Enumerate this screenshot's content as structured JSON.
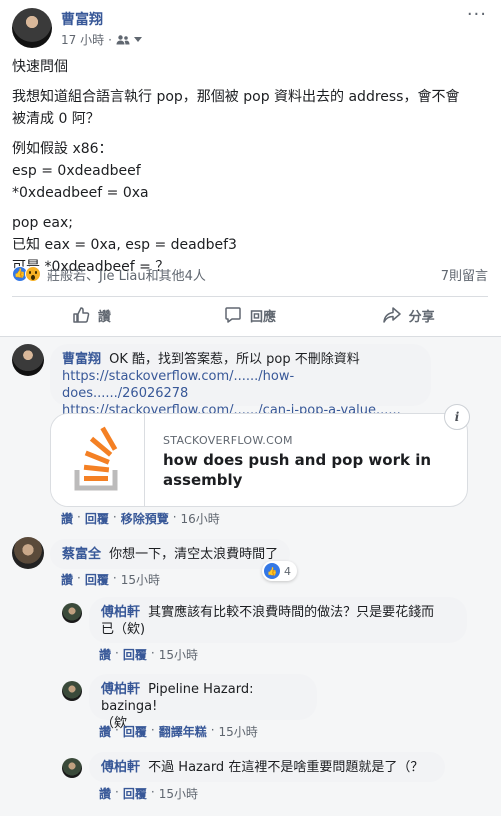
{
  "post": {
    "author": "曹富翔",
    "time": "17 小時",
    "more": "···",
    "lines": [
      "快速問個",
      "我想知道組合語言執行 pop，那個被 pop 資料出去的 address，會不會",
      "被清成 0 阿？",
      "例如假設 x86：",
      "esp = 0xdeadbeef",
      "*0xdeadbeef = 0xa",
      "pop eax;",
      "已知 eax = 0xa, esp = deadbef3",
      "可是 *0xdeadbeef = ？"
    ],
    "reaction_names": "莊般若、Jie Liau和其他4人",
    "comment_count": "7則留言",
    "actions": {
      "like": "讚",
      "comment": "回應",
      "share": "分享"
    }
  },
  "comments": [
    {
      "name": "曹富翔",
      "text": "OK 酷，找到答案惹，所以 pop 不刪除資料",
      "links": [
        "https://stackoverflow.com/....../how-does....../26026278",
        "https://stackoverflow.com/....../can-i-pop-a-value......"
      ],
      "card": {
        "domain": "STACKOVERFLOW.COM",
        "title": "how does push and pop work in assembly",
        "info": "i"
      },
      "actions": {
        "like": "讚",
        "reply": "回覆",
        "extra": "移除預覽",
        "time": "16小時"
      }
    },
    {
      "name": "蔡富全",
      "text": "你想一下，清空太浪費時間了",
      "likes": "4",
      "actions": {
        "like": "讚",
        "reply": "回覆",
        "time": "15小時"
      }
    }
  ],
  "replies": [
    {
      "name": "傅柏軒",
      "text_line1": "其實應該有比較不浪費時間的做法？只是要花錢而",
      "text_line2": "已（欸)",
      "actions": {
        "like": "讚",
        "reply": "回覆",
        "time": "15小時"
      }
    },
    {
      "name": "傅柏軒",
      "text_line1": "Pipeline Hazard: bazinga!",
      "text_line2": "（欸",
      "actions": {
        "like": "讚",
        "reply": "回覆",
        "extra": "翻譯年糕",
        "time": "15小時"
      }
    },
    {
      "name": "傅柏軒",
      "text_line1": "不過 Hazard 在這裡不是啥重要問題就是了（？",
      "actions": {
        "like": "讚",
        "reply": "回覆",
        "time": "15小時"
      }
    }
  ],
  "colors": {
    "link": "#385898",
    "meta": "#606770",
    "bubble": "#f2f3f5",
    "like_blue": "#3578e5",
    "so_orange": "#f48024"
  }
}
